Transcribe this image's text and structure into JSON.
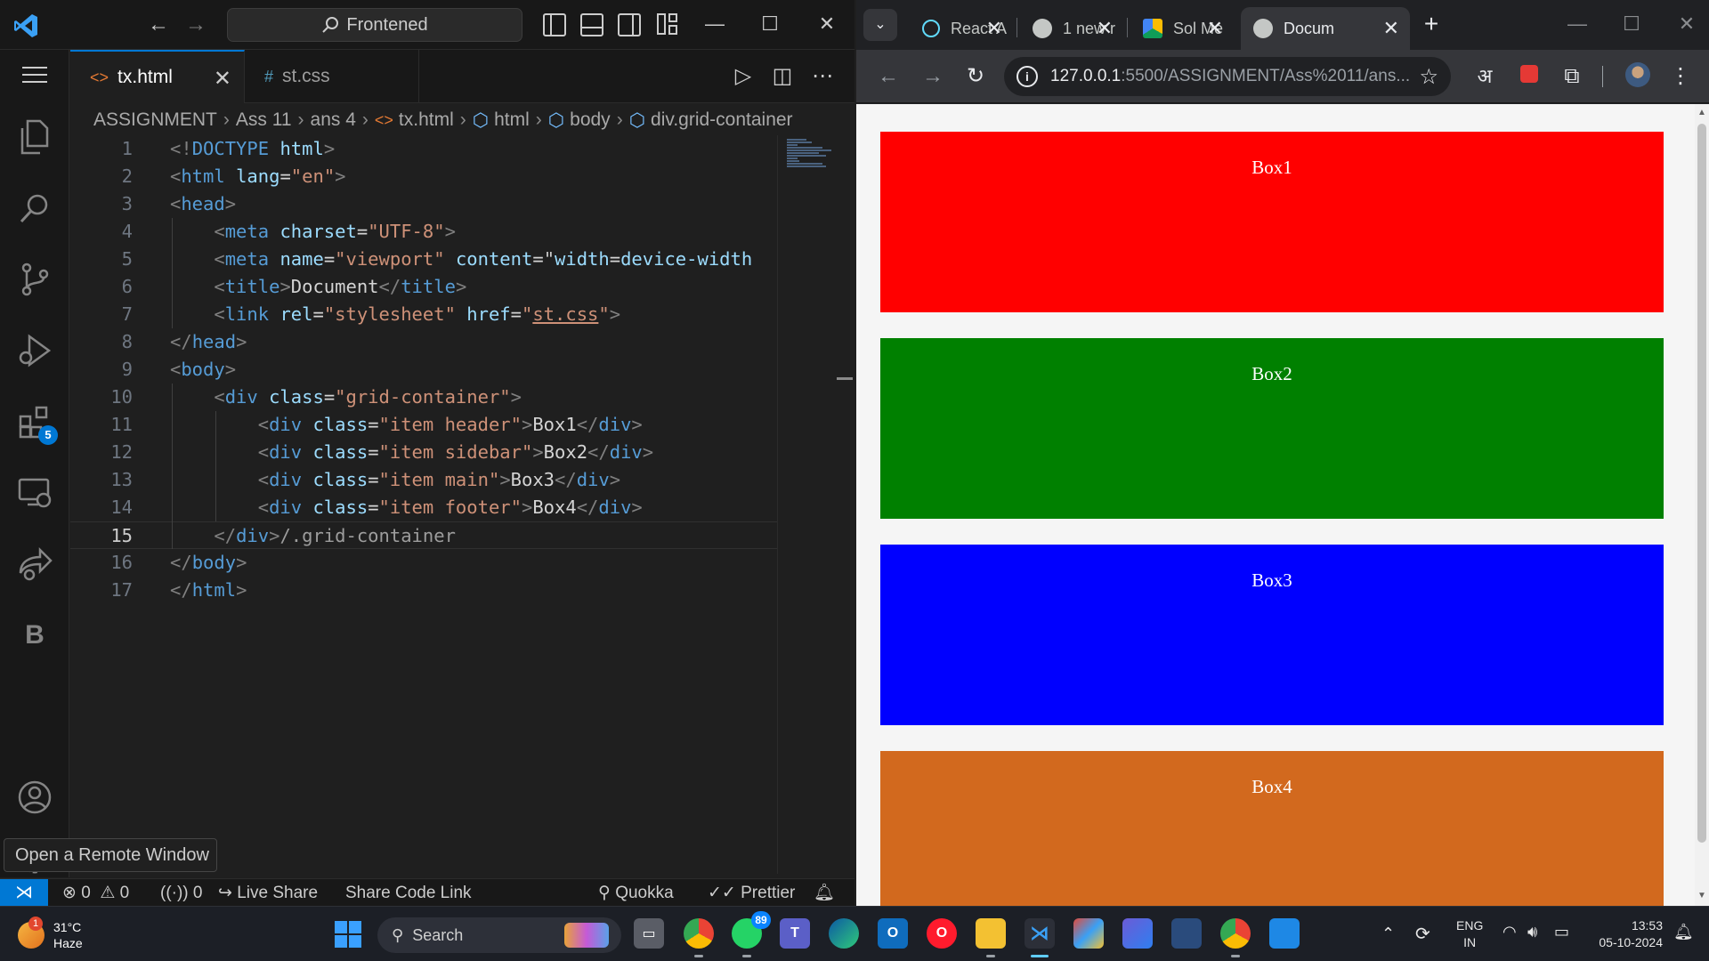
{
  "vscode": {
    "command_center": "Frontened",
    "tabs": [
      {
        "label": "tx.html",
        "icon": "<>",
        "active": true
      },
      {
        "label": "st.css",
        "icon": "#",
        "active": false
      }
    ],
    "breadcrumb": [
      "ASSIGNMENT",
      "Ass 11",
      "ans 4",
      "tx.html",
      "html",
      "body",
      "div.grid-container"
    ],
    "code_lines": [
      "<!DOCTYPE html>",
      "<html lang=\"en\">",
      "<head>",
      "    <meta charset=\"UTF-8\">",
      "    <meta name=\"viewport\" content=\"width=device-width,",
      "    <title>Document</title>",
      "    <link rel=\"stylesheet\" href=\"st.css\">",
      "</head>",
      "<body>",
      "    <div class=\"grid-container\">",
      "        <div class=\"item header\">Box1</div>",
      "        <div class=\"item sidebar\">Box2</div>",
      "        <div class=\"item main\">Box3</div>",
      "        <div class=\"item footer\">Box4</div>",
      "    </div>/.grid-container",
      "</body>",
      "</html>"
    ],
    "current_line": 15,
    "activity_badge": "5",
    "tooltip": "Open a Remote Window",
    "status": {
      "errors": "0",
      "warnings": "0",
      "ports": "0",
      "live_share": "Live Share",
      "share_code_link": "Share Code Link",
      "quokka": "Quokka",
      "prettier": "Prettier"
    }
  },
  "chrome": {
    "tabs": [
      {
        "label": "React A",
        "favicon": "react-icon"
      },
      {
        "label": "1 new r",
        "favicon": "globe-icon"
      },
      {
        "label": "Sol Me",
        "favicon": "drive-icon"
      },
      {
        "label": "Docum",
        "favicon": "globe-icon",
        "active": true
      }
    ],
    "url_host": "127.0.0.1",
    "url_path": ":5500/ASSIGNMENT/Ass%2011/ans...",
    "lang_button": "अ",
    "boxes": [
      {
        "label": "Box1",
        "color": "#ff0000"
      },
      {
        "label": "Box2",
        "color": "#008000"
      },
      {
        "label": "Box3",
        "color": "#0000ff"
      },
      {
        "label": "Box4",
        "color": "#d2691e"
      }
    ]
  },
  "taskbar": {
    "weather_temp": "31°C",
    "weather_desc": "Haze",
    "weather_badge": "1",
    "search_label": "Search",
    "whatsapp_badge": "89",
    "lang_top": "ENG",
    "lang_bottom": "IN",
    "time": "13:53",
    "date": "05-10-2024"
  },
  "colors": {
    "vscode_accent": "#0078d4",
    "box1": "#ff0000",
    "box2": "#008000",
    "box3": "#0000ff",
    "box4": "#d2691e"
  }
}
